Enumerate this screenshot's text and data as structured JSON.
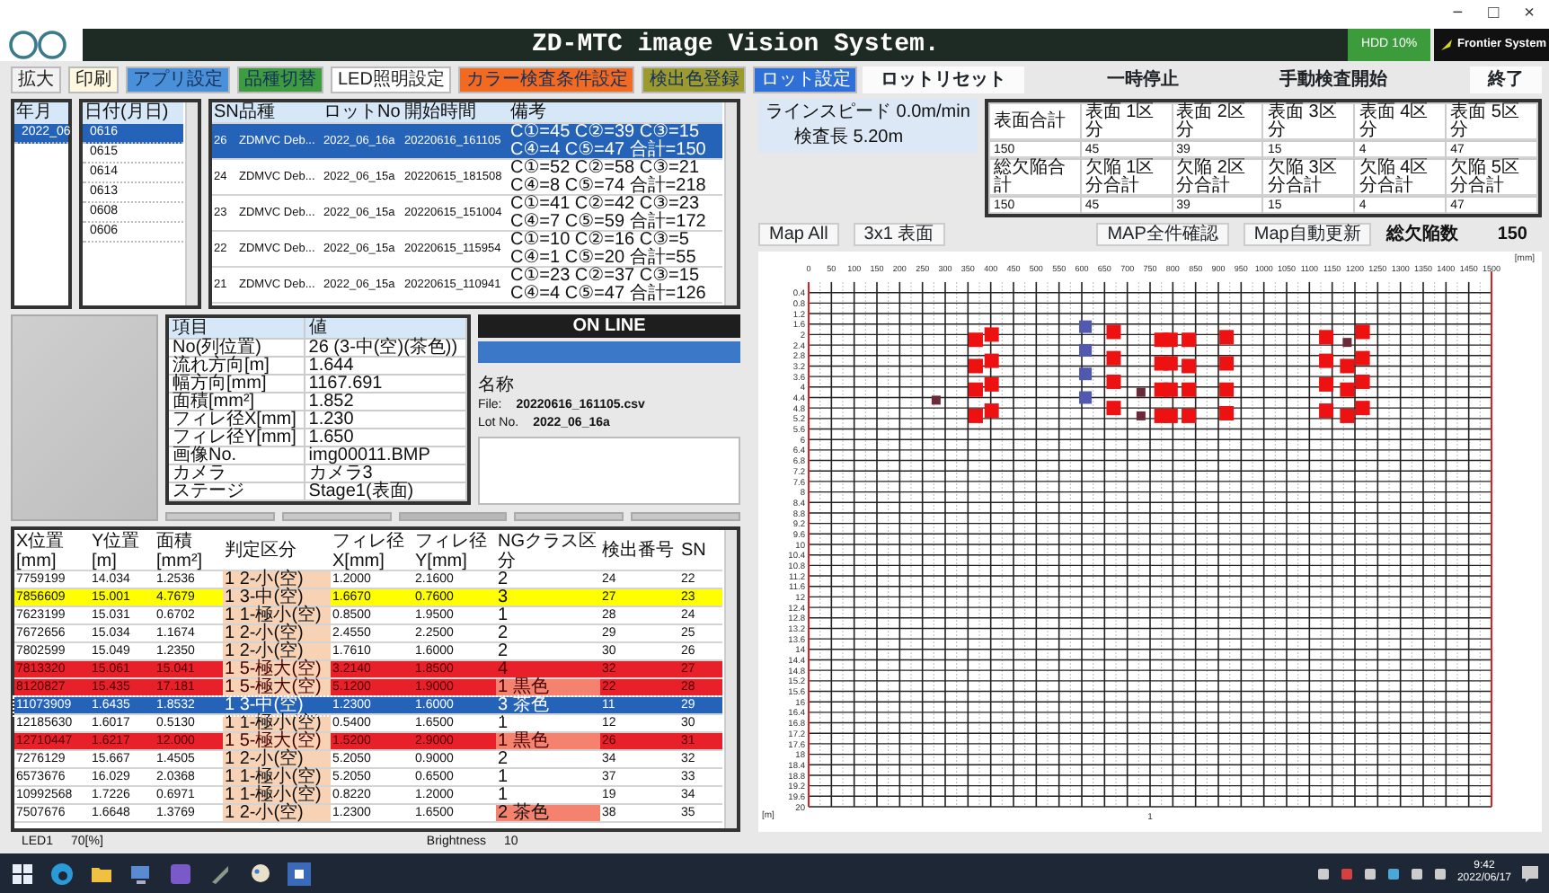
{
  "window": {
    "controls": [
      "−",
      "□",
      "×"
    ]
  },
  "title_bar": {
    "title": "ZD-MTC image Vision System.",
    "hdd": "HDD 10%",
    "brand": "Frontier System"
  },
  "toolbar": [
    {
      "label": "拡大",
      "color": "#f2f2f2"
    },
    {
      "label": "印刷",
      "color": "#fff8e1"
    },
    {
      "label": "アプリ設定",
      "color": "#4a90d9"
    },
    {
      "label": "品種切替",
      "color": "#3f9b3f"
    },
    {
      "label": "LED照明設定",
      "color": "#ffffff"
    },
    {
      "label": "カラー検査条件設定",
      "color": "#f26a22"
    },
    {
      "label": "検出色登録",
      "color": "#9c9a2e"
    },
    {
      "label": "ロット設定",
      "color": "#2f6fd8"
    }
  ],
  "month_list": {
    "header": "年月",
    "items": [
      {
        "label": "2022_06",
        "selected": true
      }
    ]
  },
  "date_list": {
    "header": "日付(月日)",
    "items": [
      {
        "label": "0616",
        "selected": true
      },
      {
        "label": "0615",
        "selected": false
      },
      {
        "label": "0614",
        "selected": false
      },
      {
        "label": "0613",
        "selected": false
      },
      {
        "label": "0608",
        "selected": false
      },
      {
        "label": "0606",
        "selected": false
      }
    ]
  },
  "lot_table": {
    "columns": [
      "SN",
      "品種",
      "ロットNo",
      "開始時間",
      "備考"
    ],
    "rows": [
      {
        "cells": [
          "26",
          "ZDMVC Deb...",
          "2022_06_16a",
          "20220616_161105",
          "C①=45 C②=39 C③=15 C④=4 C⑤=47 合計=150"
        ],
        "selected": true
      },
      {
        "cells": [
          "24",
          "ZDMVC Deb...",
          "2022_06_15a",
          "20220615_181508",
          "C①=52 C②=58 C③=21 C④=8 C⑤=74 合計=218"
        ],
        "selected": false
      },
      {
        "cells": [
          "23",
          "ZDMVC Deb...",
          "2022_06_15a",
          "20220615_151004",
          "C①=41 C②=42 C③=23 C④=7 C⑤=59 合計=172"
        ],
        "selected": false
      },
      {
        "cells": [
          "22",
          "ZDMVC Deb...",
          "2022_06_15a",
          "20220615_115954",
          "C①=10 C②=16 C③=5 C④=1 C⑤=20 合計=55"
        ],
        "selected": false
      },
      {
        "cells": [
          "21",
          "ZDMVC Deb...",
          "2022_06_15a",
          "20220615_110941",
          "C①=23 C②=37 C③=15 C④=4 C⑤=47 合計=126"
        ],
        "selected": false
      }
    ]
  },
  "control_buttons": [
    {
      "label": "ロットリセット",
      "kind": "raised"
    },
    {
      "label": "一時停止",
      "kind": "flat"
    },
    {
      "label": "手動検査開始",
      "kind": "flat"
    },
    {
      "label": "終了",
      "kind": "raised"
    }
  ],
  "line_status": {
    "speed": "ラインスピード 0.0m/min",
    "length": "検査長 5.20m"
  },
  "totals_table": {
    "rows": [
      [
        "表面合計",
        "表面 1区分",
        "表面 2区分",
        "表面 3区分",
        "表面 4区分",
        "表面 5区分"
      ],
      [
        "150",
        "45",
        "39",
        "15",
        "4",
        "47"
      ],
      [
        "総欠陥合計",
        "欠陥 1区分合計",
        "欠陥 2区分合計",
        "欠陥 3区分合計",
        "欠陥 4区分合計",
        "欠陥 5区分合計"
      ],
      [
        "150",
        "45",
        "39",
        "15",
        "4",
        "47"
      ]
    ]
  },
  "map_toolbar": {
    "left_buttons": [
      "Map All",
      "3x1 表面"
    ],
    "center_buttons": [
      "MAP全件確認",
      "Map自動更新"
    ],
    "total_label": "総欠陥数",
    "total_value": "150"
  },
  "info_table": {
    "columns": [
      "項目",
      "値"
    ],
    "rows": [
      [
        "No(列位置)",
        "26 (3-中(空)(茶色))"
      ],
      [
        "流れ方向[m]",
        "1.644"
      ],
      [
        "幅方向[mm]",
        "1167.691"
      ],
      [
        "面積[mm²]",
        "1.852"
      ],
      [
        "フィレ径X[mm]",
        "1.230"
      ],
      [
        "フィレ径Y[mm]",
        "1.650"
      ],
      [
        "画像No.",
        "img00011.BMP"
      ],
      [
        "カメラ",
        "カメラ3"
      ],
      [
        "ステージ",
        "Stage1(表面)"
      ]
    ]
  },
  "status_panel": {
    "state": "ON LINE",
    "name_label": "名称",
    "file_label": "File:",
    "file": "20220616_161105.csv",
    "lot_label": "Lot No.",
    "lot": "2022_06_16a"
  },
  "defect_table": {
    "columns": [
      "X位置[mm]",
      "Y位置[m]",
      "面積[mm²]",
      "判定区分",
      "フィレ径X[mm]",
      "フィレ径Y[mm]",
      "NGクラス区分",
      "検出番号",
      "SN"
    ],
    "rows": [
      {
        "cells": [
          "7759199",
          "14.034",
          "1.2536",
          "1 2-小(空)",
          "1.2000",
          "2.1600",
          "2",
          "24",
          "22"
        ],
        "color": "#ffffff",
        "ng_highlight": false,
        "selected": false
      },
      {
        "cells": [
          "7856609",
          "15.001",
          "4.7679",
          "1 3-中(空)",
          "1.6670",
          "0.7600",
          "3",
          "27",
          "23"
        ],
        "color": "#ffff00",
        "ng_highlight": false,
        "selected": false
      },
      {
        "cells": [
          "7623199",
          "15.031",
          "0.6702",
          "1 1-極小(空)",
          "0.8500",
          "1.9500",
          "1",
          "28",
          "24"
        ],
        "color": "#ffffff",
        "ng_highlight": false,
        "selected": false
      },
      {
        "cells": [
          "7672656",
          "15.034",
          "1.1674",
          "1 2-小(空)",
          "2.4550",
          "2.2500",
          "2",
          "29",
          "25"
        ],
        "color": "#ffffff",
        "ng_highlight": false,
        "selected": false
      },
      {
        "cells": [
          "7802599",
          "15.049",
          "1.2350",
          "1 2-小(空)",
          "1.7610",
          "1.6000",
          "2",
          "30",
          "26"
        ],
        "color": "#ffffff",
        "ng_highlight": false,
        "selected": false
      },
      {
        "cells": [
          "7813320",
          "15.061",
          "15.041",
          "1 5-極大(空)",
          "3.2140",
          "1.8500",
          "4",
          "32",
          "27"
        ],
        "color": "#e8202a",
        "ng_highlight": false,
        "selected": false
      },
      {
        "cells": [
          "8120827",
          "15.435",
          "17.181",
          "1 5-極大(空)",
          "5.1200",
          "1.9000",
          "1 黒色",
          "22",
          "28"
        ],
        "color": "#e8202a",
        "ng_highlight": true,
        "selected": false
      },
      {
        "cells": [
          "11073909",
          "1.6435",
          "1.8532",
          "1 3-中(空)",
          "1.2300",
          "1.6000",
          "3 茶色",
          "11",
          "29"
        ],
        "color": "#2563b8",
        "ng_highlight": false,
        "selected": true
      },
      {
        "cells": [
          "12185630",
          "1.6017",
          "0.5130",
          "1 1-極小(空)",
          "0.5400",
          "1.6500",
          "1",
          "12",
          "30"
        ],
        "color": "#ffffff",
        "ng_highlight": false,
        "selected": false
      },
      {
        "cells": [
          "12710447",
          "1.6217",
          "12.000",
          "1 5-極大(空)",
          "1.5200",
          "2.9000",
          "1 黒色",
          "26",
          "31"
        ],
        "color": "#e8202a",
        "ng_highlight": true,
        "selected": false
      },
      {
        "cells": [
          "7276129",
          "15.667",
          "1.4505",
          "1 2-小(空)",
          "5.2050",
          "0.9000",
          "2",
          "34",
          "32"
        ],
        "color": "#ffffff",
        "ng_highlight": false,
        "selected": false
      },
      {
        "cells": [
          "6573676",
          "16.029",
          "2.0368",
          "1 1-極小(空)",
          "5.2050",
          "0.6500",
          "1",
          "37",
          "33"
        ],
        "color": "#ffffff",
        "ng_highlight": false,
        "selected": false
      },
      {
        "cells": [
          "10992568",
          "1.7226",
          "0.6971",
          "1 1-極小(空)",
          "0.8220",
          "1.2000",
          "1",
          "19",
          "34"
        ],
        "color": "#ffffff",
        "ng_highlight": false,
        "selected": false
      },
      {
        "cells": [
          "7507676",
          "1.6648",
          "1.3769",
          "1 2-小(空)",
          "1.2300",
          "1.6500",
          "2 茶色",
          "38",
          "35"
        ],
        "color": "#ffffff",
        "ng_highlight": true,
        "selected": false
      }
    ]
  },
  "map": {
    "chart_data": {
      "type": "scatter",
      "xlabel": "[mm]",
      "ylabel": "[m]",
      "xlim": [
        0,
        1500
      ],
      "ylim": [
        20,
        0
      ],
      "grid": true,
      "xticks": [
        0,
        50,
        100,
        150,
        200,
        250,
        300,
        350,
        400,
        450,
        500,
        550,
        600,
        650,
        700,
        750,
        800,
        850,
        900,
        950,
        1000,
        1050,
        1100,
        1150,
        1200,
        1250,
        1300,
        1350,
        1400,
        1450,
        1500
      ],
      "yticks": [
        0.4,
        0.8,
        1.2,
        1.6,
        2,
        2.4,
        2.8,
        3.2,
        3.6,
        4,
        4.4,
        4.8,
        5.2,
        5.6,
        6,
        6.4,
        6.8,
        7.2,
        7.6,
        8,
        8.4,
        8.8,
        9.2,
        9.6,
        10,
        10.4,
        10.8,
        11.2,
        11.6,
        12,
        12.4,
        12.8,
        13.2,
        13.6,
        14,
        14.4,
        14.8,
        15.2,
        15.6,
        16,
        16.4,
        16.8,
        17.2,
        17.6,
        18,
        18.4,
        18.8,
        19.2,
        19.6,
        20
      ],
      "series": [
        {
          "color": "#ee1111",
          "x": [
            367,
            367,
            367,
            367,
            402,
            402,
            402,
            402,
            670,
            670,
            670,
            670,
            775,
            775,
            775,
            775,
            795,
            795,
            795,
            795,
            835,
            835,
            835,
            835,
            918,
            918,
            918,
            918,
            1137,
            1137,
            1137,
            1137,
            1183,
            1183,
            1183,
            1217,
            1217,
            1217,
            1217
          ],
          "values": [
            2.2,
            3.2,
            4.1,
            5.1,
            2.0,
            3.0,
            3.9,
            4.9,
            1.9,
            2.9,
            3.8,
            4.8,
            2.2,
            3.1,
            4.1,
            5.1,
            2.2,
            3.1,
            4.1,
            5.1,
            2.2,
            3.2,
            4.1,
            5.1,
            2.1,
            3.1,
            4.1,
            5.0,
            2.1,
            3.0,
            3.9,
            4.9,
            3.2,
            4.1,
            5.1,
            1.9,
            2.9,
            3.8,
            4.8
          ]
        },
        {
          "color": "#5058b0",
          "x": [
            608,
            608,
            608,
            608
          ],
          "values": [
            1.7,
            2.6,
            3.5,
            4.4
          ]
        },
        {
          "color": "#6a2a3a",
          "x": [
            280,
            730,
            730,
            1183
          ],
          "values": [
            4.5,
            4.2,
            5.1,
            2.3
          ]
        }
      ],
      "annotations": [
        "1"
      ]
    }
  },
  "status_bar": {
    "led": "LED1",
    "led_value": "70[%]",
    "brightness_label": "Brightness",
    "brightness": "10"
  },
  "taskbar": {
    "time": "9:42",
    "date": "2022/06/17"
  }
}
